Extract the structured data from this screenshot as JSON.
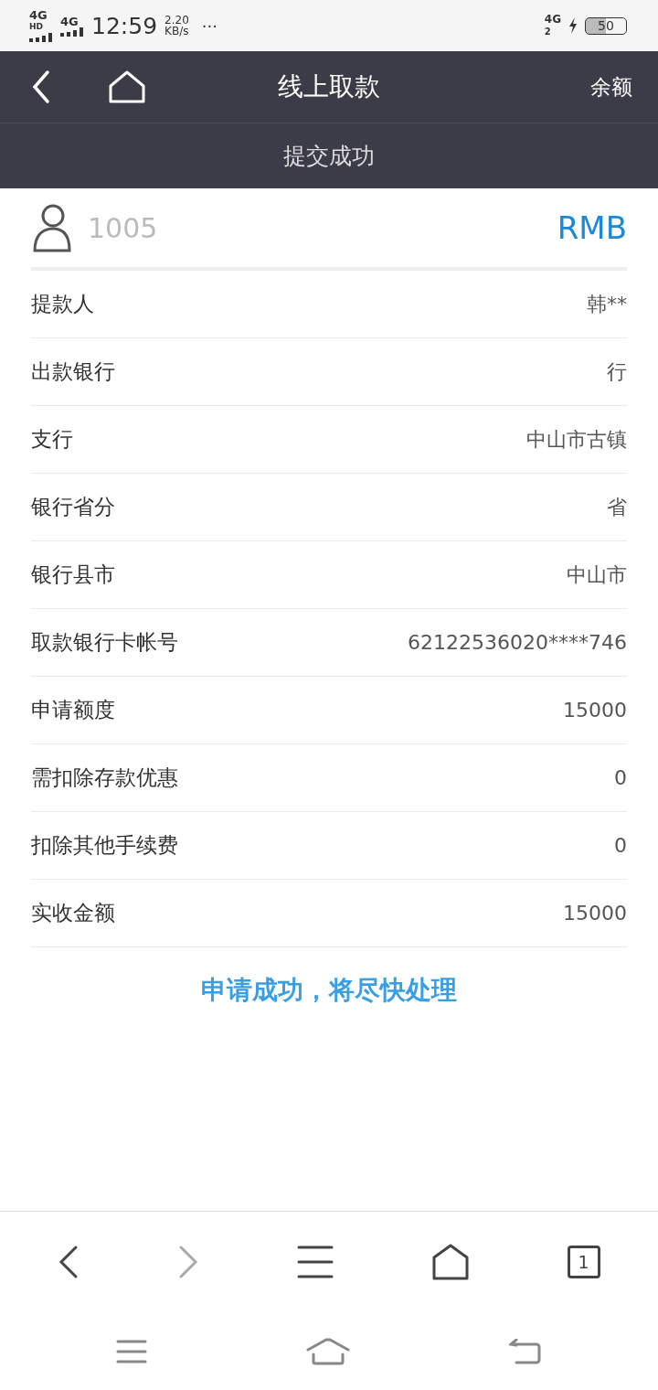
{
  "status_bar": {
    "network_1": "4G",
    "network_1_badge": "HD",
    "network_2": "4G",
    "time": "12:59",
    "speed": "2.20",
    "speed_unit": "KB/s",
    "more": "···",
    "network_3": "4G",
    "network_3_sub": "2",
    "battery": "50"
  },
  "header": {
    "title": "线上取款",
    "action": "余额"
  },
  "subheader": {
    "title": "提交成功"
  },
  "account": {
    "username": "1005",
    "currency": "RMB"
  },
  "rows": [
    {
      "label": "提款人",
      "value": "韩**"
    },
    {
      "label": "出款银行",
      "value": "行"
    },
    {
      "label": "支行",
      "value": "中山市古镇"
    },
    {
      "label": "银行省分",
      "value": "省"
    },
    {
      "label": "银行县市",
      "value": "中山市"
    },
    {
      "label": "取款银行卡帐号",
      "value": "62122536020****746"
    },
    {
      "label": "申请额度",
      "value": "15000"
    },
    {
      "label": "需扣除存款优惠",
      "value": "0"
    },
    {
      "label": "扣除其他手续费",
      "value": "0"
    },
    {
      "label": "实收金额",
      "value": "15000"
    }
  ],
  "message": "申请成功，将尽快处理",
  "browser_bar": {
    "forward_disabled": true,
    "tab_count": "1"
  }
}
